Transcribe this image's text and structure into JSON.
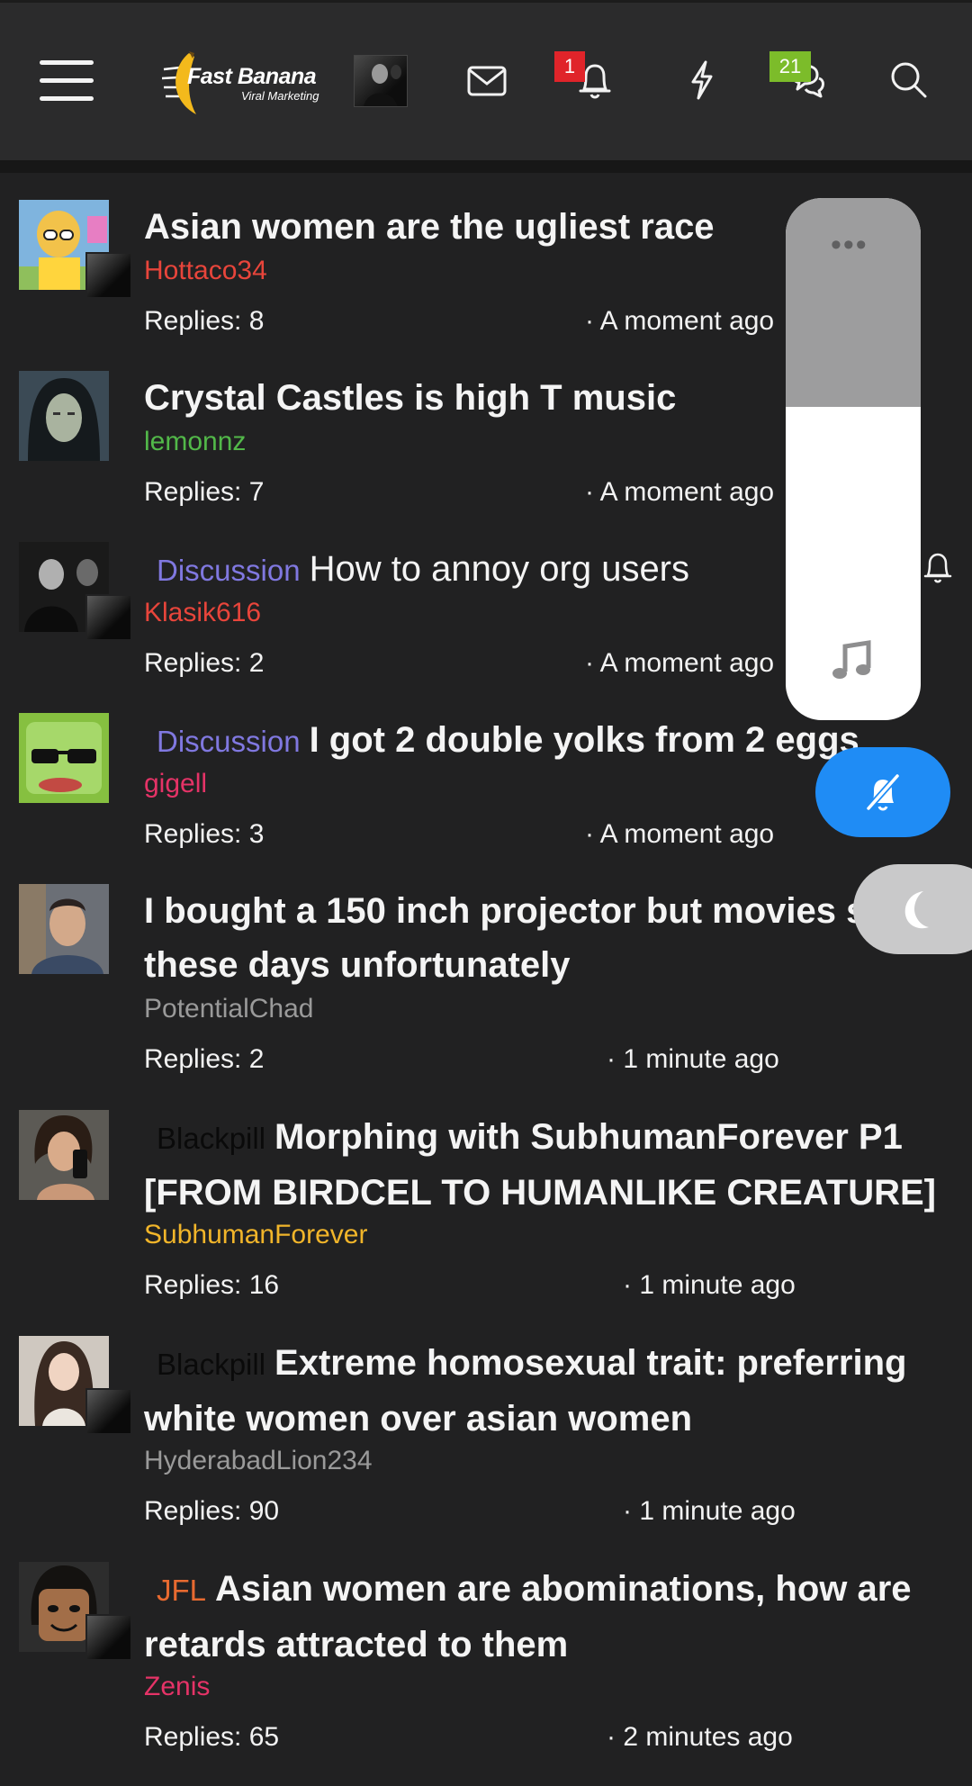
{
  "header": {
    "logo_title": "Fast Banana",
    "logo_subtitle": "Viral Marketing",
    "alerts_badge": "1",
    "conversations_badge": "21"
  },
  "colors": {
    "red_username": "#e8453b",
    "green_username": "#52b849",
    "pink_username": "#e53367",
    "gray_username": "#9a9a9a",
    "gold_username": "#f1b52a",
    "discussion_prefix": "#8078e0",
    "blackpill_prefix": "#0a0a0a",
    "jfl_prefix": "#e86a30",
    "mute_button": "#1f8cf5"
  },
  "threads": [
    {
      "title": "Asian women are the ugliest race",
      "prefix": "",
      "author": "Hottaco34",
      "replies": "Replies: 8",
      "time": "· A moment ago"
    },
    {
      "title": "Crystal Castles is high T music",
      "prefix": "",
      "author": "lemonnz",
      "replies": "Replies: 7",
      "time": "· A moment ago"
    },
    {
      "title": "How to annoy org users",
      "prefix": "Discussion",
      "author": "Klasik616",
      "replies": "Replies: 2",
      "time": "· A moment ago"
    },
    {
      "title": "I got 2 double yolks from 2 eggs",
      "prefix": "Discussion",
      "author": "gigell",
      "replies": "Replies: 3",
      "time": "· A moment ago"
    },
    {
      "title": "I bought a 150 inch projector but movies suck these days unfortunately",
      "prefix": "",
      "author": "PotentialChad",
      "replies": "Replies: 2",
      "time": "· 1 minute ago"
    },
    {
      "title": "Morphing with SubhumanForever P1 [FROM BIRDCEL TO HUMANLIKE CREATURE]",
      "prefix": "Blackpill",
      "author": "SubhumanForever",
      "replies": "Replies: 16",
      "time": "· 1 minute ago"
    },
    {
      "title": "Extreme homosexual trait: preferring white women over asian women",
      "prefix": "Blackpill",
      "author": "HyderabadLion234",
      "replies": "Replies: 90",
      "time": "· 1 minute ago"
    },
    {
      "title": "Asian women are abominations, how are retards attracted to them",
      "prefix": "JFL",
      "author": "Zenis",
      "replies": "Replies: 65",
      "time": "· 2 minutes ago"
    }
  ],
  "overlay": {
    "volume_menu_icon": "more-dots-icon",
    "music_icon": "music-note-icon",
    "volume_level": 0.6
  }
}
